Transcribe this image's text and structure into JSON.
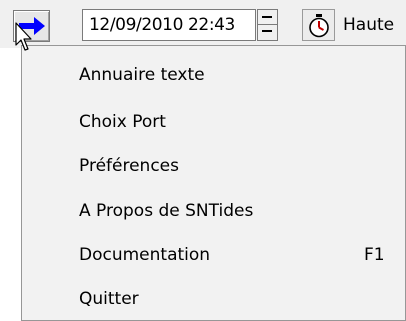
{
  "toolbar": {
    "date_time_value": "12/09/2010 22:43",
    "spinner_up_label": "spin-up",
    "spinner_down_label": "spin-down",
    "partial_label": "Haute",
    "icons": {
      "arrow": "right-arrow-icon",
      "timer": "stopwatch-icon"
    },
    "colors": {
      "arrow_blue": "#0000ff",
      "timer_red": "#c00000"
    }
  },
  "menu": {
    "items": [
      {
        "label": "Annuaire texte",
        "shortcut": ""
      },
      {
        "label": "Choix Port",
        "shortcut": ""
      },
      {
        "label": "Préférences",
        "shortcut": ""
      },
      {
        "label": "A Propos de SNTides",
        "shortcut": ""
      },
      {
        "label": "Documentation",
        "shortcut": "F1"
      },
      {
        "label": "Quitter",
        "shortcut": ""
      }
    ]
  }
}
